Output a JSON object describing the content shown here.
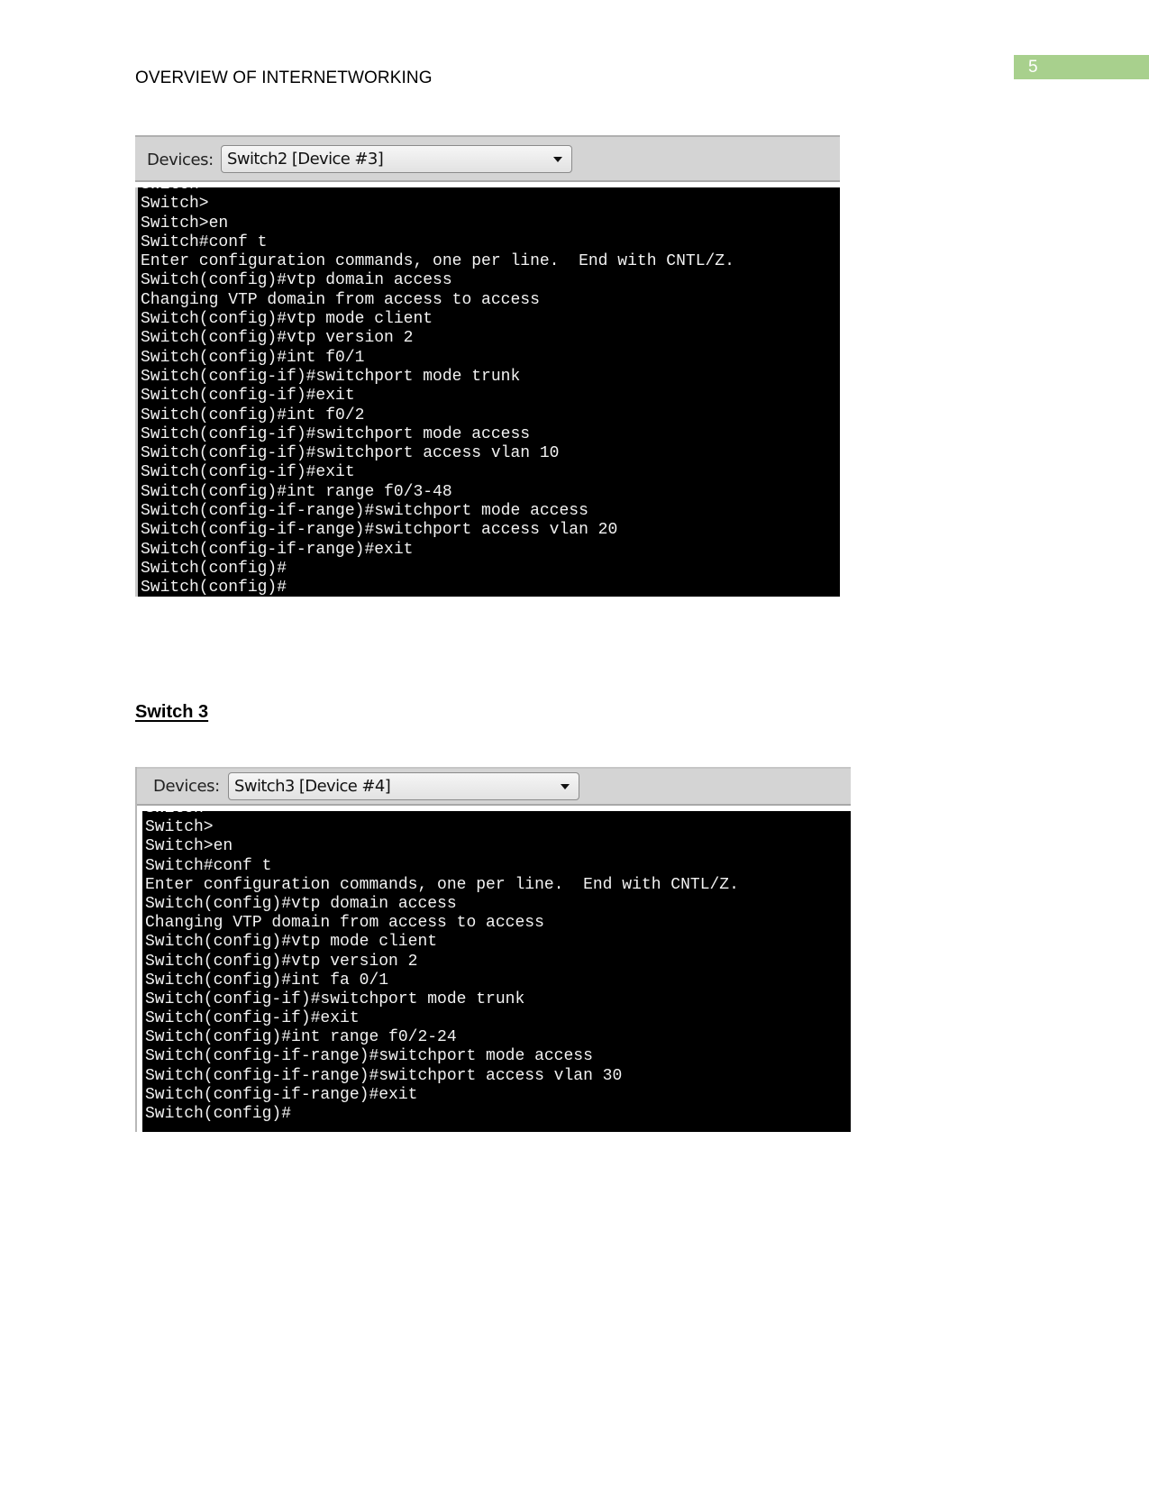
{
  "page": {
    "number": "5",
    "running_head": "OVERVIEW OF INTERNETWORKING",
    "accent_color": "#a8d08d"
  },
  "figures": [
    {
      "devices_label": "Devices:",
      "selected_device": "Switch2 [Device #3]",
      "terminal_lines": [
        "Switch>",
        "Switch>",
        "Switch>en",
        "Switch#conf t",
        "Enter configuration commands, one per line.  End with CNTL/Z.",
        "Switch(config)#vtp domain access",
        "Changing VTP domain from access to access",
        "Switch(config)#vtp mode client",
        "Switch(config)#vtp version 2",
        "Switch(config)#int f0/1",
        "Switch(config-if)#switchport mode trunk",
        "Switch(config-if)#exit",
        "Switch(config)#int f0/2",
        "Switch(config-if)#switchport mode access",
        "Switch(config-if)#switchport access vlan 10",
        "Switch(config-if)#exit",
        "Switch(config)#int range f0/3-48",
        "Switch(config-if-range)#switchport mode access",
        "Switch(config-if-range)#switchport access vlan 20",
        "Switch(config-if-range)#exit",
        "Switch(config)#",
        "Switch(config)#"
      ]
    },
    {
      "heading": "Switch 3",
      "devices_label": "Devices:",
      "selected_device": "Switch3 [Device #4]",
      "terminal_lines": [
        "Switch>",
        "Switch>",
        "Switch>en",
        "Switch#conf t",
        "Enter configuration commands, one per line.  End with CNTL/Z.",
        "Switch(config)#vtp domain access",
        "Changing VTP domain from access to access",
        "Switch(config)#vtp mode client",
        "Switch(config)#vtp version 2",
        "Switch(config)#int fa 0/1",
        "Switch(config-if)#switchport mode trunk",
        "Switch(config-if)#exit",
        "Switch(config)#int range f0/2-24",
        "Switch(config-if-range)#switchport mode access",
        "Switch(config-if-range)#switchport access vlan 30",
        "Switch(config-if-range)#exit",
        "Switch(config)#"
      ]
    }
  ]
}
